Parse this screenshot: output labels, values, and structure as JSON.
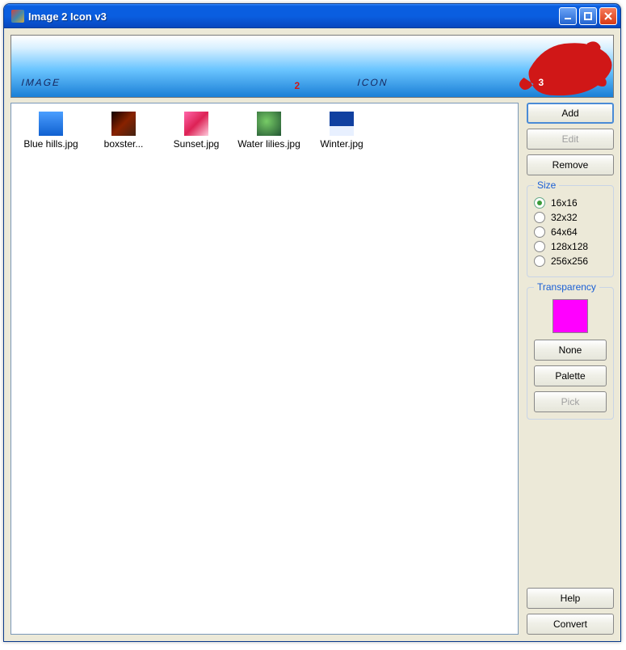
{
  "window": {
    "title": "Image 2 Icon v3"
  },
  "banner": {
    "text1": "IMAGE",
    "text2": "2",
    "text3": "ICON",
    "text4": "3"
  },
  "files": [
    {
      "label": "Blue hills.jpg",
      "thumb": "blue"
    },
    {
      "label": "boxster...",
      "thumb": "dark"
    },
    {
      "label": "Sunset.jpg",
      "thumb": "pink"
    },
    {
      "label": "Water lilies.jpg",
      "thumb": "green"
    },
    {
      "label": "Winter.jpg",
      "thumb": "winter"
    }
  ],
  "buttons": {
    "add": "Add",
    "edit": "Edit",
    "remove": "Remove",
    "none": "None",
    "palette": "Palette",
    "pick": "Pick",
    "help": "Help",
    "convert": "Convert"
  },
  "groups": {
    "size": "Size",
    "transparency": "Transparency"
  },
  "sizes": [
    {
      "label": "16x16",
      "selected": true
    },
    {
      "label": "32x32",
      "selected": false
    },
    {
      "label": "64x64",
      "selected": false
    },
    {
      "label": "128x128",
      "selected": false
    },
    {
      "label": "256x256",
      "selected": false
    }
  ],
  "transparencyColor": "#ff00ff"
}
